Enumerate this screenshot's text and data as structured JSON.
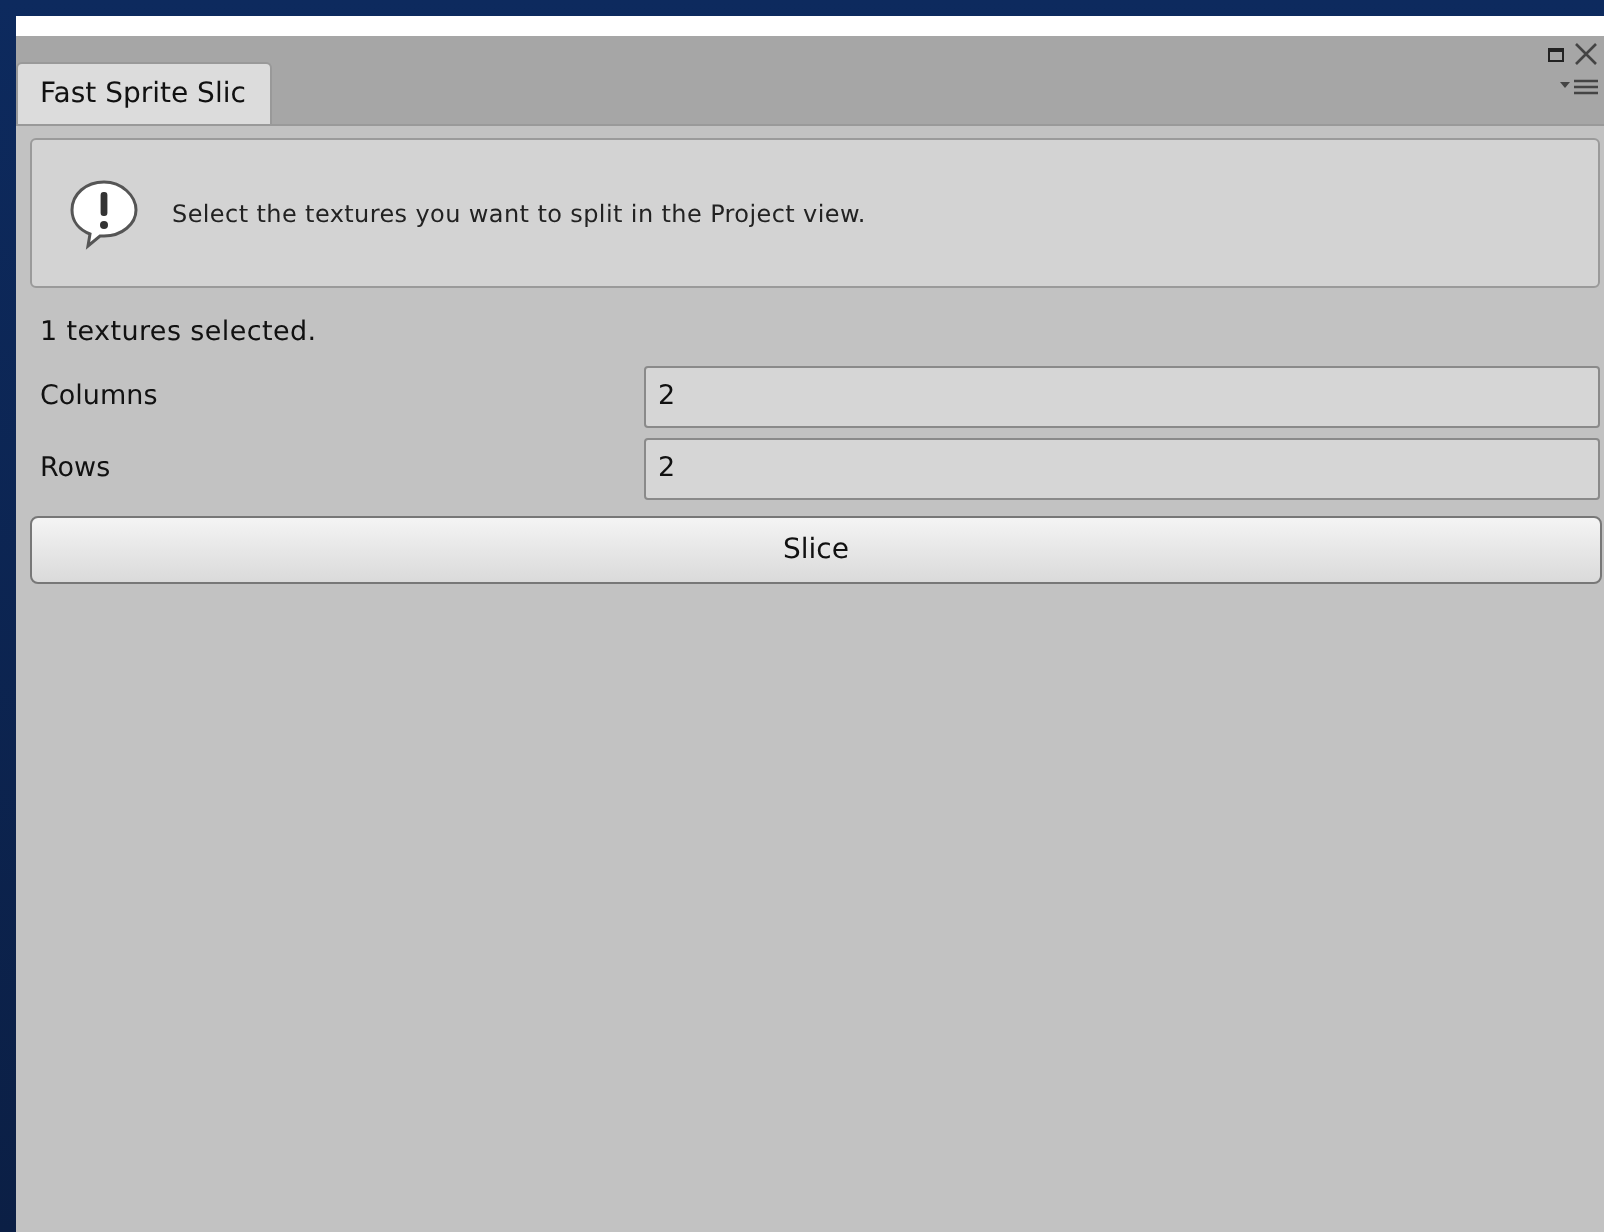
{
  "window": {
    "tab": {
      "label": "Fast Sprite Slic",
      "selected": true
    }
  },
  "help_box": {
    "kind": "info",
    "message": "Select the textures you want to split in the Project view."
  },
  "status": "1 textures selected.",
  "fields": [
    {
      "label": "Columns",
      "value": "2"
    },
    {
      "label": "Rows",
      "value": "2"
    }
  ],
  "button": "Slice"
}
